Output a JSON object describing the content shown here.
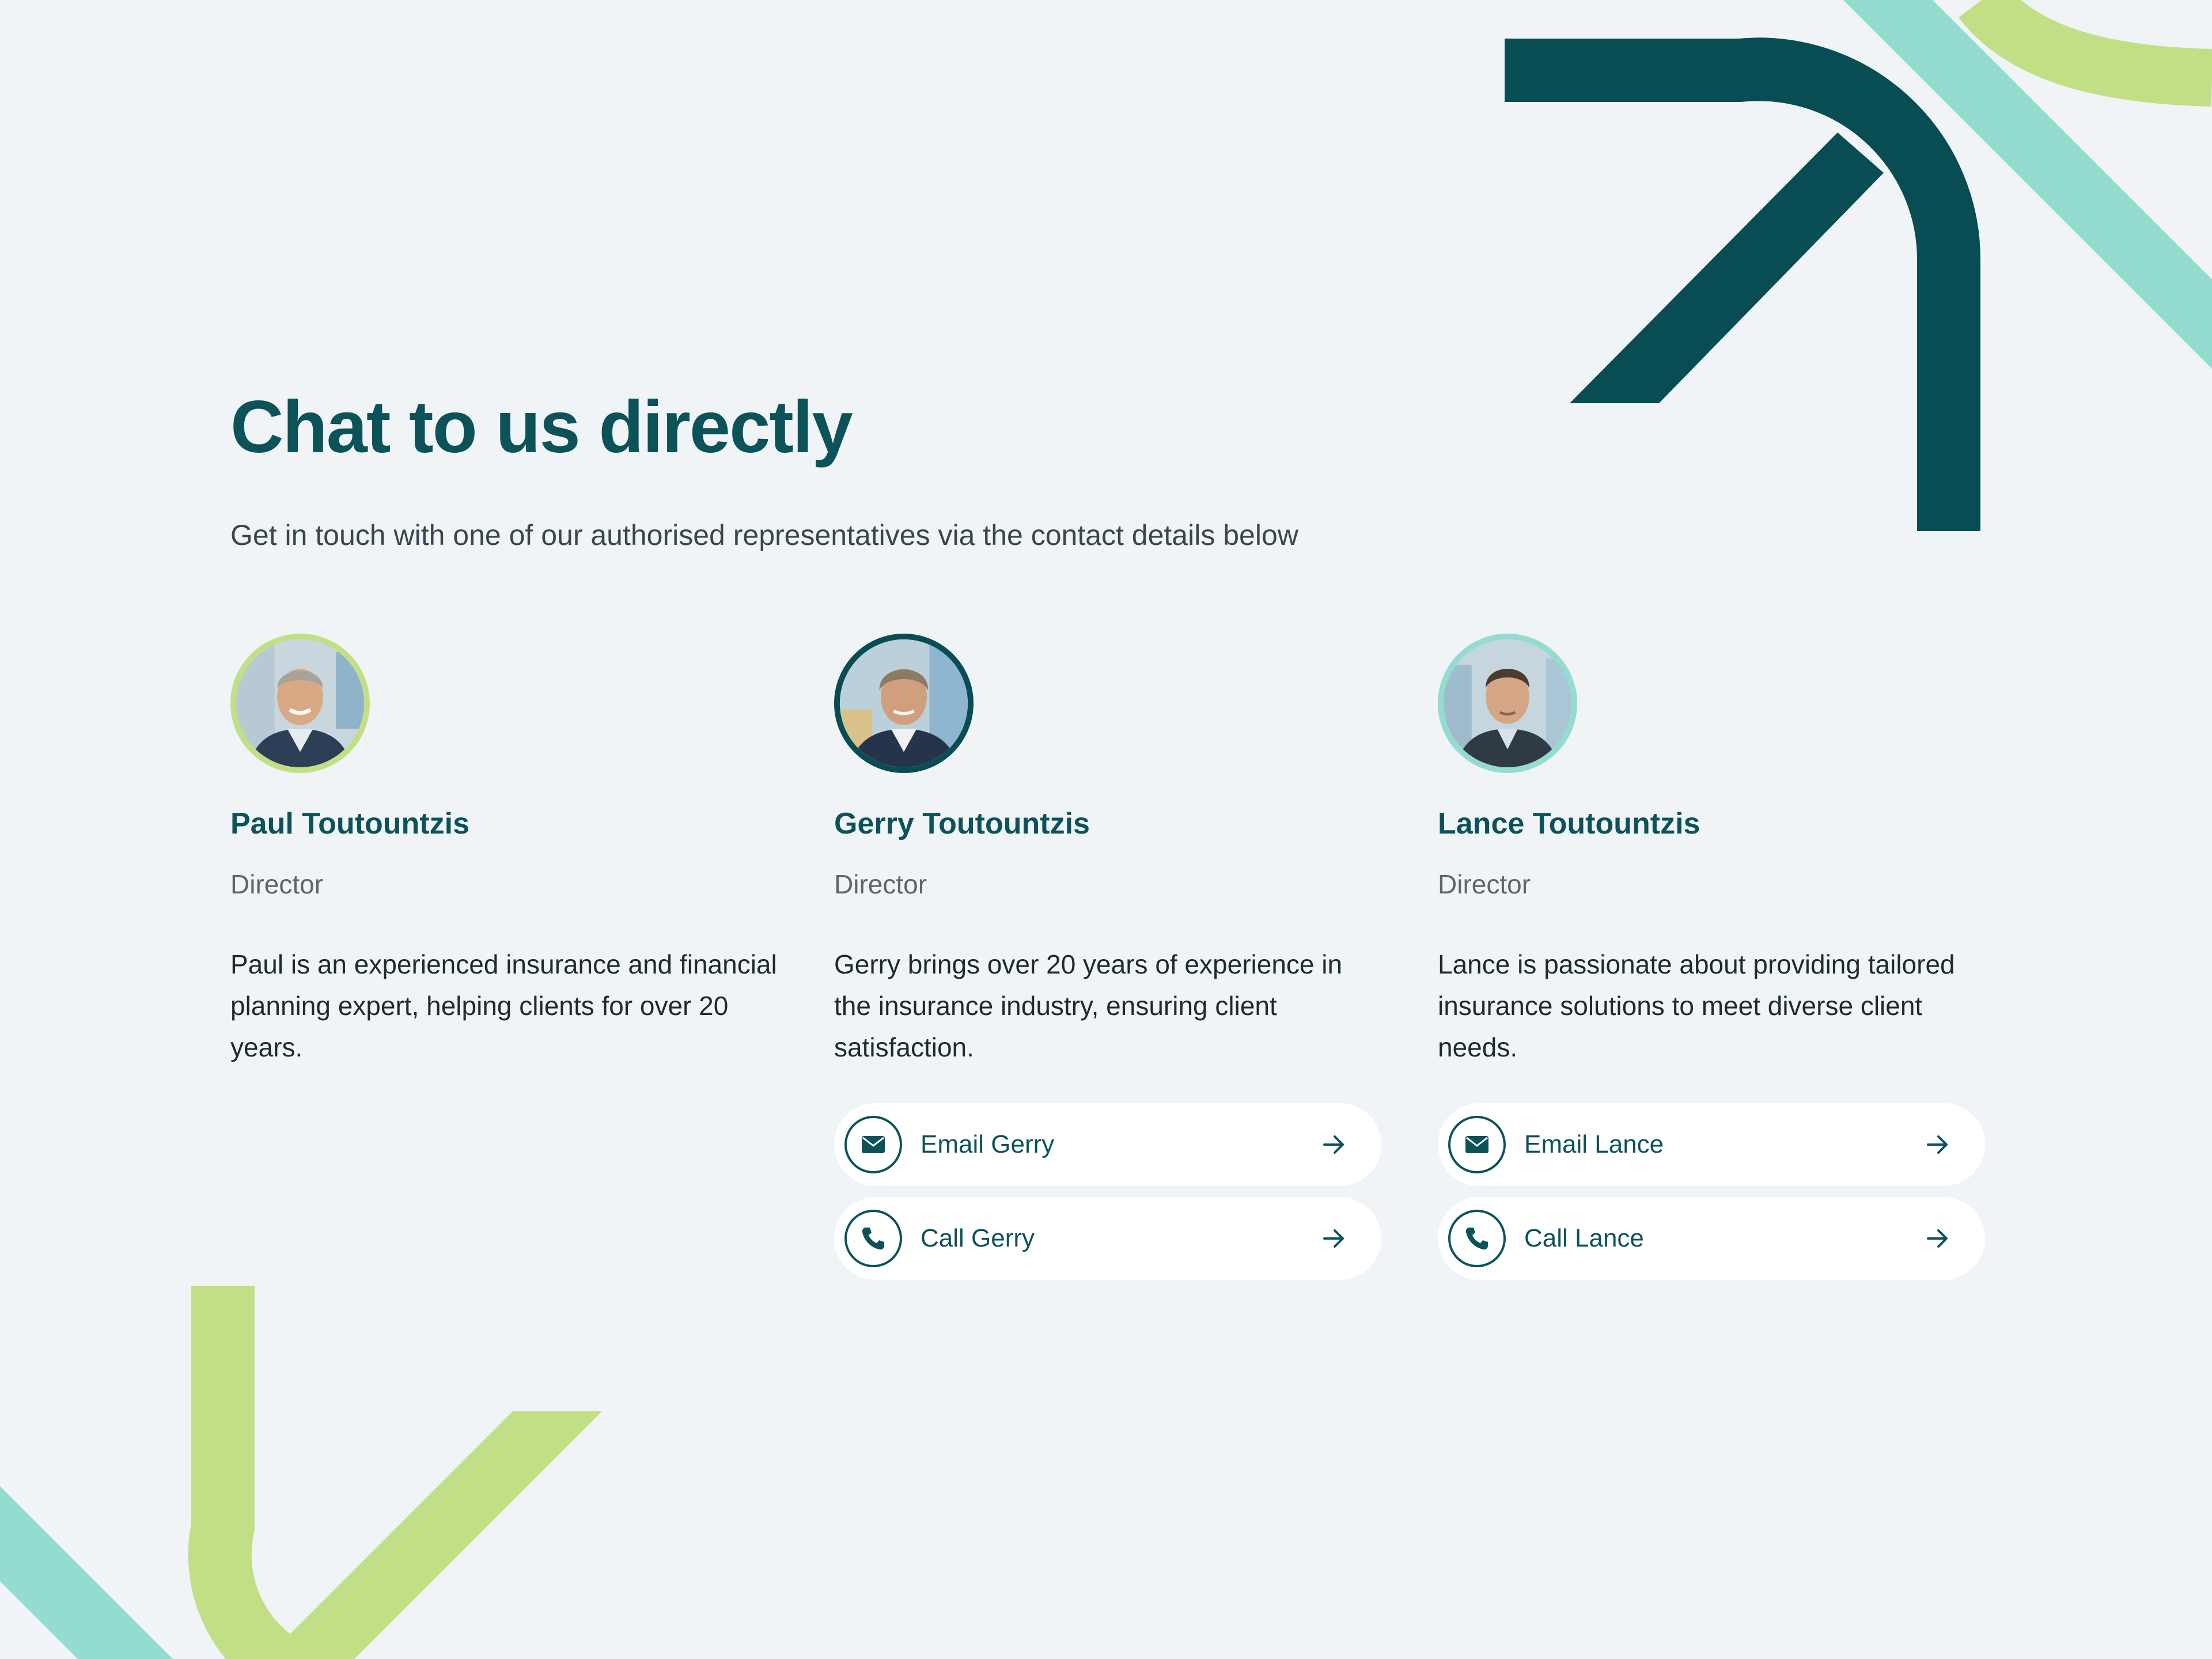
{
  "colors": {
    "background": "#f0f4f7",
    "brand_dark_teal": "#074d53",
    "heading_teal": "#0c5259",
    "accent_mint": "#93dccf",
    "accent_lime": "#c3df85",
    "button_bg": "#ffffff"
  },
  "section": {
    "title": "Chat to us directly",
    "subtitle": "Get in touch with one of our authorised representatives via the contact details below"
  },
  "people": [
    {
      "name": "Paul Toutountzis",
      "role": "Director",
      "bio": "Paul is an experienced insurance and financial planning expert, helping clients for over 20 years.",
      "avatar_ring": "lime"
    },
    {
      "name": "Gerry Toutountzis",
      "role": "Director",
      "bio": "Gerry brings over 20 years of experience in the insurance industry, ensuring client satisfaction.",
      "avatar_ring": "dark-teal",
      "email_label": "Email Gerry",
      "call_label": "Call Gerry"
    },
    {
      "name": "Lance Toutountzis",
      "role": "Director",
      "bio": "Lance is passionate about providing tailored insurance solutions to meet diverse client needs.",
      "avatar_ring": "mint",
      "email_label": "Email Lance",
      "call_label": "Call Lance"
    }
  ],
  "icons": {
    "email": "envelope-icon",
    "call": "phone-icon",
    "go": "arrow-right-icon"
  }
}
